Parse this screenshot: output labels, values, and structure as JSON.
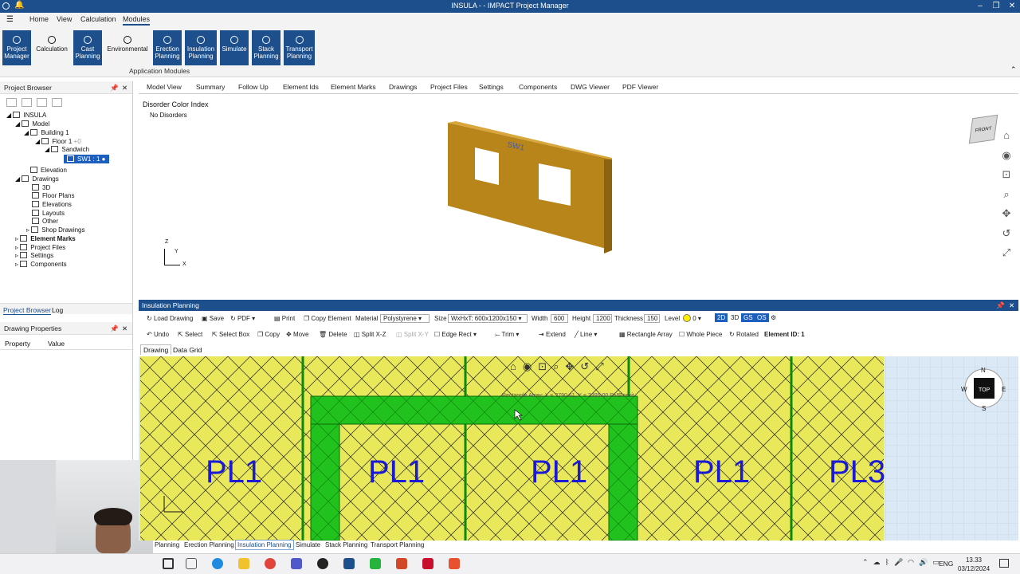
{
  "window": {
    "title": "INSULA -  - IMPACT Project Manager"
  },
  "menu": [
    "Home",
    "View",
    "Calculation",
    "Modules"
  ],
  "ribbon": {
    "buttons": [
      "Project Manager",
      "Calculation",
      "Cast Planning",
      "Environmental",
      "Erection Planning",
      "Insulation Planning",
      "Simulate",
      "Stack Planning",
      "Transport Planning"
    ],
    "group": "Application Modules"
  },
  "browser": {
    "title": "Project Browser",
    "tabs": [
      "Project Browser",
      "Log"
    ],
    "tree": [
      "INSULA",
      "Model",
      "Building 1",
      "Floor 1",
      "+0",
      "Sandwich",
      "SW1 : 1",
      "Elevation",
      "Drawings",
      "3D",
      "Floor Plans",
      "Elevations",
      "Layouts",
      "Other",
      "Shop Drawings",
      "Element Marks",
      "Project Files",
      "Settings",
      "Components"
    ]
  },
  "props": {
    "title": "Drawing Properties",
    "cols": [
      "Property",
      "Value"
    ]
  },
  "tabs": [
    "Model View",
    "Summary",
    "Follow Up",
    "Element Ids",
    "Element Marks",
    "Drawings",
    "Project Files",
    "Settings",
    "Components",
    "DWG Viewer",
    "PDF Viewer"
  ],
  "view3d": {
    "title": "Disorder Color Index",
    "sub": "No Disorders",
    "wall_label": "SW1",
    "axes": [
      "Z",
      "Y",
      "X"
    ],
    "cube": "FRONT"
  },
  "insulation": {
    "title": "Insulation Planning",
    "row1": {
      "load": "Load Drawing",
      "save": "Save",
      "pdf": "PDF",
      "print": "Print",
      "copy_el": "Copy Element",
      "material_l": "Material",
      "material": "Polystyrene",
      "size_l": "Size",
      "size": "WxHxT: 600x1200x150",
      "width_l": "Width",
      "width": "600",
      "height_l": "Height",
      "height": "1200",
      "thick_l": "Thickness",
      "thick": "150",
      "level_l": "Level",
      "level": "0",
      "b2d": "2D",
      "b3d": "3D",
      "gs": "GS",
      "os": "OS"
    },
    "row2": {
      "undo": "Undo",
      "select": "Select",
      "selbox": "Select Box",
      "copy": "Copy",
      "move": "Move",
      "delete": "Delete",
      "split": "Split X-Z",
      "splitxy": "Split X-Y",
      "edge": "Edge Rect",
      "trim": "Trim",
      "extend": "Extend",
      "line": "Line",
      "rect": "Rectangle Array",
      "whole": "Whole Piece",
      "rot": "Rotated",
      "elid": "Element ID: 1"
    },
    "subtabs": [
      "Drawing",
      "Data Grid"
    ],
    "panels": [
      "PL1",
      "PL1",
      "PL1",
      "PL1",
      "PL3"
    ],
    "status": "Rectangle Array: X = 3790.61, Y = 2395.00  RMB=exit",
    "compass": {
      "n": "N",
      "s": "S",
      "e": "E",
      "w": "W",
      "c": "TOP"
    }
  },
  "bottom_tabs": [
    "Planning",
    "Erection Planning",
    "Insulation Planning",
    "Simulate",
    "Stack Planning",
    "Transport Planning"
  ],
  "taskbar": {
    "lang": "ENG",
    "time": "13.33",
    "date": "03/12/2024"
  },
  "colors": {
    "accent": "#1c4f8c",
    "panel": "#e8e85a",
    "green": "#22c21e",
    "wall": "#c9931a",
    "label": "#1a1ad6"
  }
}
